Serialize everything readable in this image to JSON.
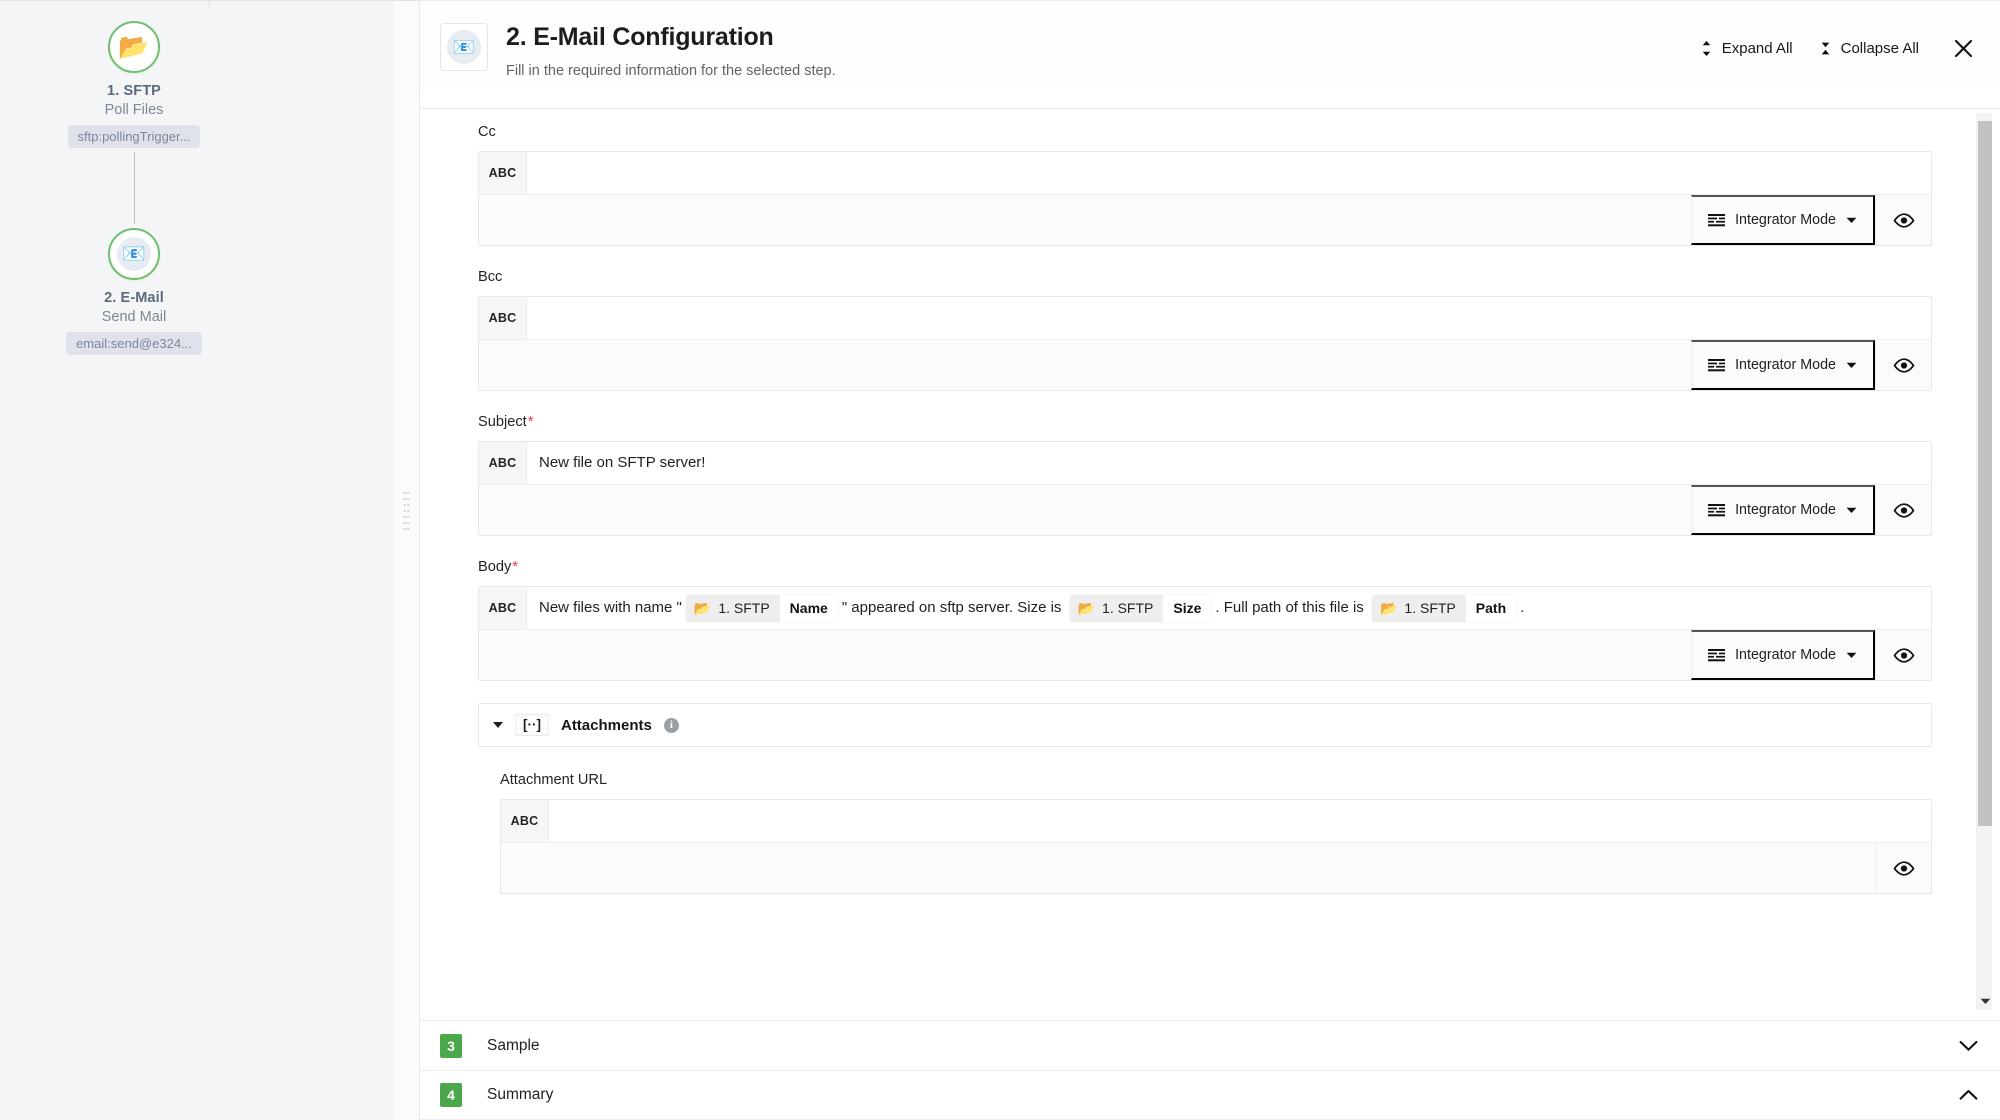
{
  "flow": {
    "nodes": [
      {
        "icon": "folder-icon",
        "glyph": "📂",
        "title": "1. SFTP",
        "subtitle": "Poll Files",
        "tag": "sftp:pollingTrigger..."
      },
      {
        "icon": "mail-icon",
        "glyph": "📧",
        "title": "2. E-Mail",
        "subtitle": "Send Mail",
        "tag": "email:send@e324..."
      }
    ]
  },
  "header": {
    "icon": "mail-icon",
    "icon_glyph": "📧",
    "title": "2. E-Mail Configuration",
    "subtitle": "Fill in the required information for the selected step.",
    "expand_all": "Expand All",
    "collapse_all": "Collapse All",
    "close": "×"
  },
  "common": {
    "abc": "ABC",
    "integrator_mode": "Integrator Mode",
    "eye_label": "Preview"
  },
  "fields": {
    "cc": {
      "label": "Cc",
      "value": "",
      "required": false
    },
    "bcc": {
      "label": "Bcc",
      "value": "",
      "required": false
    },
    "subject": {
      "label": "Subject",
      "value": "New file on SFTP server!",
      "required": true
    },
    "body": {
      "label": "Body",
      "required": true,
      "segments": [
        {
          "type": "text",
          "text": "New files with name \""
        },
        {
          "type": "chip",
          "source": "1. SFTP",
          "key": "Name",
          "icon": "folder-icon",
          "glyph": "📂"
        },
        {
          "type": "text",
          "text": "\" appeared on sftp server. Size is "
        },
        {
          "type": "chip",
          "source": "1. SFTP",
          "key": "Size",
          "icon": "folder-icon",
          "glyph": "📂"
        },
        {
          "type": "text",
          "text": ". Full path of this file is "
        },
        {
          "type": "chip",
          "source": "1. SFTP",
          "key": "Path",
          "icon": "folder-icon",
          "glyph": "📂"
        },
        {
          "type": "text",
          "text": "."
        }
      ]
    },
    "attachment_url": {
      "label": "Attachment URL",
      "value": "",
      "required": false
    }
  },
  "attachments_group": {
    "title": "Attachments",
    "bracket": "[··]",
    "info": "i",
    "expanded": true
  },
  "steps": [
    {
      "num": "3",
      "label": "Sample",
      "state": "collapsed",
      "chevron": "down"
    },
    {
      "num": "4",
      "label": "Summary",
      "state": "expanded",
      "chevron": "up"
    }
  ],
  "colors": {
    "accent_green": "#4aa74a",
    "node_ring": "#6ec06e",
    "required_red": "#e8394a",
    "canvas_bg": "#f4f5f7"
  },
  "scrollbar": {
    "position_pct": 0
  }
}
